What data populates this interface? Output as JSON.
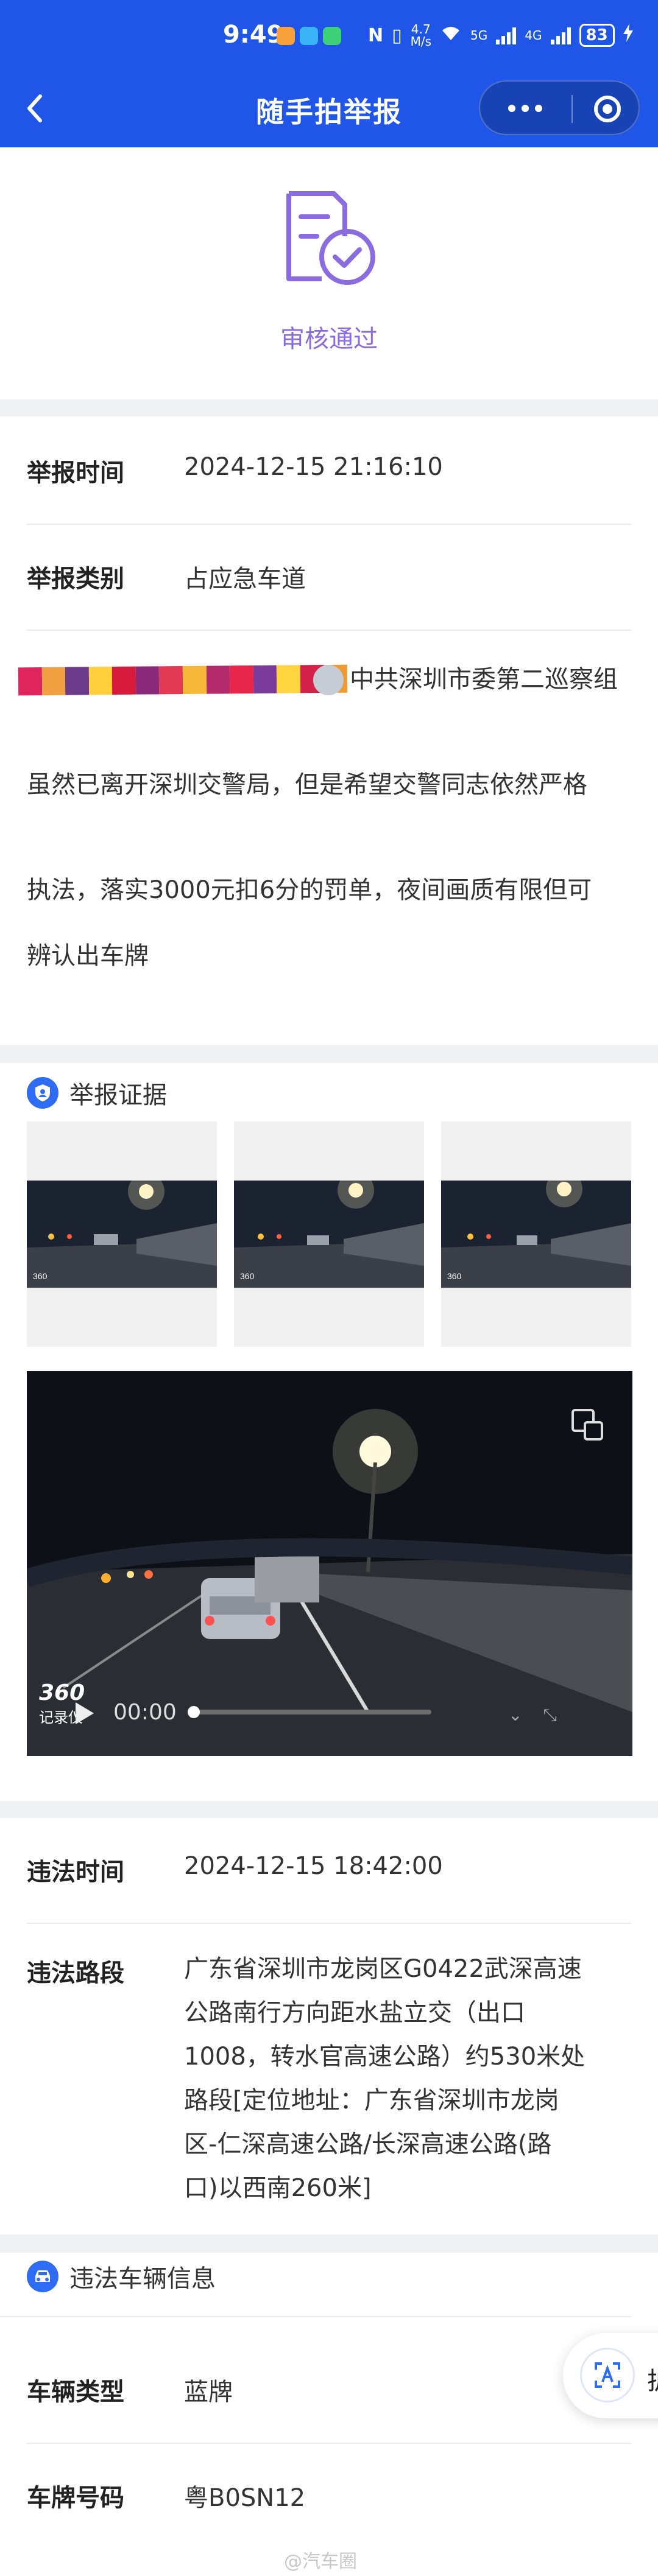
{
  "status_bar": {
    "time": "9:49",
    "net_speed_top": "4.7",
    "net_speed_bottom": "M/s",
    "net_tag_1": "5G",
    "net_tag_2": "4G",
    "battery": "83"
  },
  "nav": {
    "title": "随手拍举报",
    "back_icon": "chevron-left-icon",
    "more_icon": "more-dots-icon",
    "close_icon": "target-close-icon"
  },
  "review": {
    "status": "审核通过",
    "icon": "document-check-icon",
    "color": "#8a6be0"
  },
  "report": {
    "time_label": "举报时间",
    "time_value": "2024-12-15 21:16:10",
    "type_label": "举报类别",
    "type_value": "占应急车道",
    "description_lines": [
      "中共深圳市委第二巡察组",
      "虽然已离开深圳交警局，但是希望交警同志依然严格",
      "执法，落实3000元扣6分的罚单，夜间画质有限但可",
      "辨认出车牌"
    ]
  },
  "evidence": {
    "title": "举报证据",
    "icon": "shield-user-icon",
    "video_time": "00:00",
    "dashcam_brand": "360",
    "dashcam_sub": "记录仪",
    "video_progress": 0.0
  },
  "violation": {
    "time_label": "违法时间",
    "time_value": "2024-12-15 18:42:00",
    "place_label": "违法路段",
    "place_lines": [
      "广东省深圳市龙岗区G0422武深高速",
      "公路南行方向距水盐立交（出口",
      "1008，转水官高速公路）约530米处",
      "路段[定位地址：广东省深圳市龙岗",
      "区-仁深高速公路/长深高速公路(路",
      "口)以西南260米]"
    ]
  },
  "vehicle": {
    "title": "违法车辆信息",
    "icon": "car-icon",
    "type_label": "车辆类型",
    "type_value": "蓝牌",
    "plate_label": "车牌号码",
    "plate_value": "粤B0SN12"
  },
  "float_button": {
    "icon": "translate-icon",
    "peek_text": "护"
  },
  "watermark": "@汽车圈",
  "colors": {
    "nav_bg": "#1f56e8",
    "accent_blue": "#2f6cf5",
    "review_purple": "#8a6be0"
  }
}
